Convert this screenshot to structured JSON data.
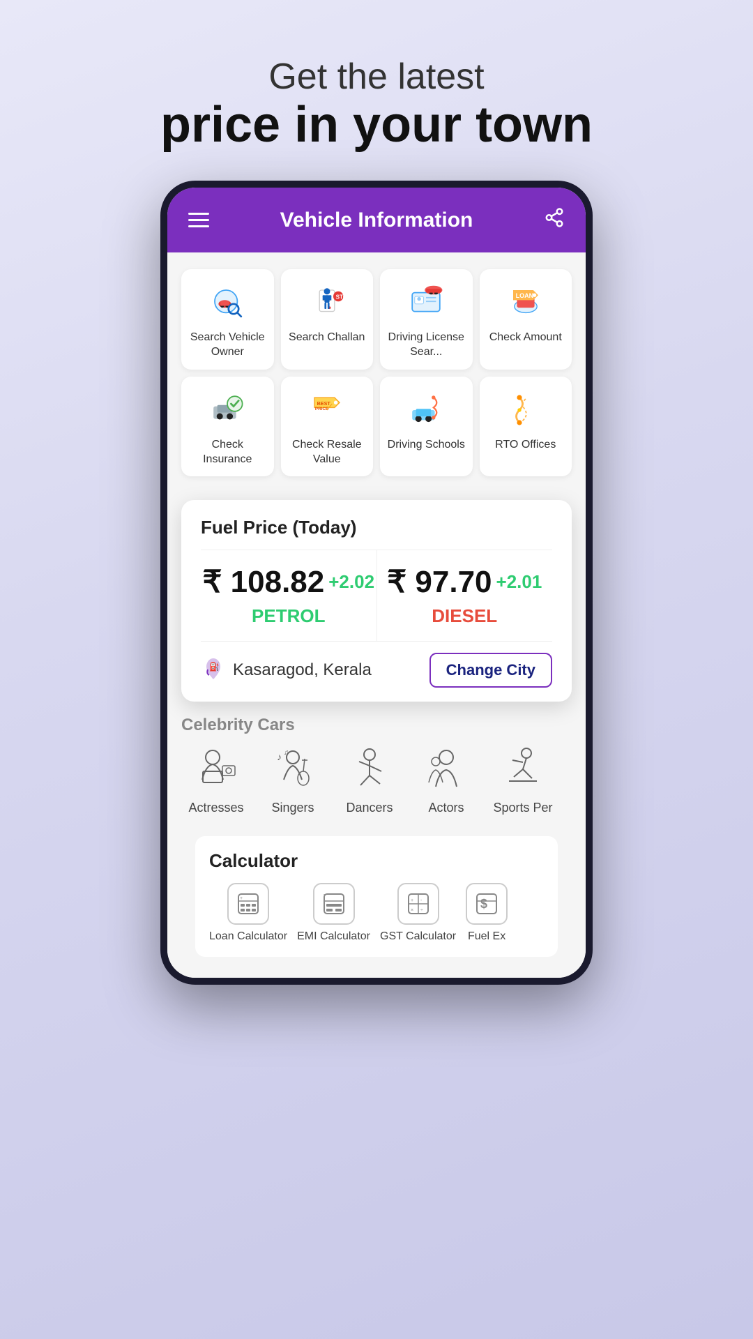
{
  "hero": {
    "subtitle": "Get the latest",
    "title": "price in your town"
  },
  "app_header": {
    "title": "Vehicle Information",
    "share_label": "share"
  },
  "vehicle_grid": {
    "items": [
      {
        "id": "search-vehicle-owner",
        "label": "Search Vehicle Owner",
        "icon": "search-car"
      },
      {
        "id": "search-challan",
        "label": "Search Challan",
        "icon": "challan"
      },
      {
        "id": "driving-license",
        "label": "Driving License Sear...",
        "icon": "driving-license"
      },
      {
        "id": "check-amount",
        "label": "Check Amount",
        "icon": "check-amount"
      },
      {
        "id": "check-insurance",
        "label": "Check Insurance",
        "icon": "insurance"
      },
      {
        "id": "check-resale",
        "label": "Check Resale Value",
        "icon": "resale"
      },
      {
        "id": "driving-schools",
        "label": "Driving Schools",
        "icon": "driving-schools"
      },
      {
        "id": "rto-offices",
        "label": "RTO Offices",
        "icon": "rto"
      }
    ]
  },
  "fuel_card": {
    "title": "Fuel Price (Today)",
    "petrol": {
      "amount": "₹ 108.82",
      "change": "+2.02",
      "label": "PETROL"
    },
    "diesel": {
      "amount": "₹ 97.70",
      "change": "+2.01",
      "label": "DIESEL"
    },
    "location": "Kasaragod, Kerala",
    "change_city_btn": "Change City"
  },
  "celebrity_section": {
    "title": "Celebrity Cars",
    "items": [
      {
        "id": "actresses",
        "label": "Actresses"
      },
      {
        "id": "singers",
        "label": "Singers"
      },
      {
        "id": "dancers",
        "label": "Dancers"
      },
      {
        "id": "actors",
        "label": "Actors"
      },
      {
        "id": "sports-persons",
        "label": "Sports Per"
      }
    ]
  },
  "calculator_section": {
    "title": "Calculator",
    "items": [
      {
        "id": "loan-calculator",
        "label": "Loan Calculator",
        "icon": "➕"
      },
      {
        "id": "emi-calculator",
        "label": "EMI Calculator",
        "icon": "🔢"
      },
      {
        "id": "gst-calculator",
        "label": "GST Calculator",
        "icon": "📊"
      },
      {
        "id": "fuel-ex",
        "label": "Fuel Ex",
        "icon": "💲"
      }
    ]
  }
}
